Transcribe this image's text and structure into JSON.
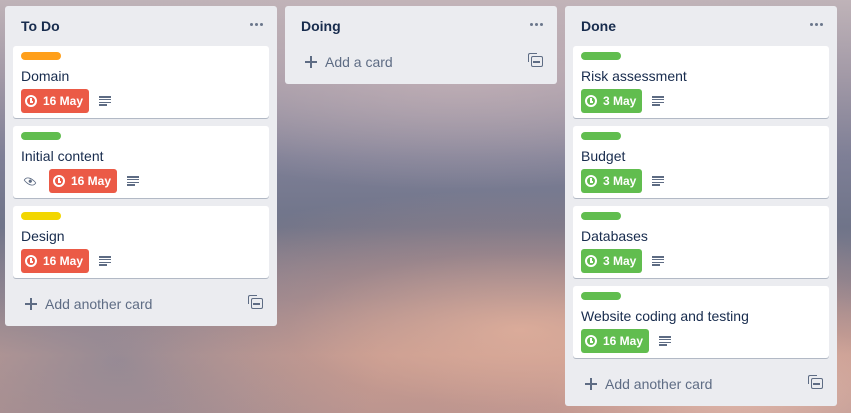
{
  "colors": {
    "overdue": "#eb5a46",
    "complete": "#61bd4f",
    "label_orange": "#ff9f1a",
    "label_green": "#61bd4f",
    "label_yellow": "#f2d600",
    "list_bg": "#ebecf0"
  },
  "lists": [
    {
      "title": "To Do",
      "add_label": "Add another card",
      "cards": [
        {
          "title": "Domain",
          "label_color": "orange",
          "due": "16 May",
          "due_status": "overdue",
          "watching": false,
          "has_description": true
        },
        {
          "title": "Initial content",
          "label_color": "green",
          "due": "16 May",
          "due_status": "overdue",
          "watching": true,
          "has_description": true
        },
        {
          "title": "Design",
          "label_color": "yellow",
          "due": "16 May",
          "due_status": "overdue",
          "watching": false,
          "has_description": true
        }
      ]
    },
    {
      "title": "Doing",
      "add_label": "Add a card",
      "cards": []
    },
    {
      "title": "Done",
      "add_label": "Add another card",
      "cards": [
        {
          "title": "Risk assessment",
          "label_color": "green",
          "due": "3 May",
          "due_status": "complete",
          "watching": false,
          "has_description": true
        },
        {
          "title": "Budget",
          "label_color": "green",
          "due": "3 May",
          "due_status": "complete",
          "watching": false,
          "has_description": true
        },
        {
          "title": "Databases",
          "label_color": "green",
          "due": "3 May",
          "due_status": "complete",
          "watching": false,
          "has_description": true
        },
        {
          "title": "Website coding and testing",
          "label_color": "green",
          "due": "16 May",
          "due_status": "complete",
          "watching": false,
          "has_description": true
        }
      ]
    }
  ],
  "icons": [
    "list-menu-icon",
    "clock-icon",
    "description-icon",
    "eye-icon",
    "plus-icon",
    "card-template-icon"
  ]
}
